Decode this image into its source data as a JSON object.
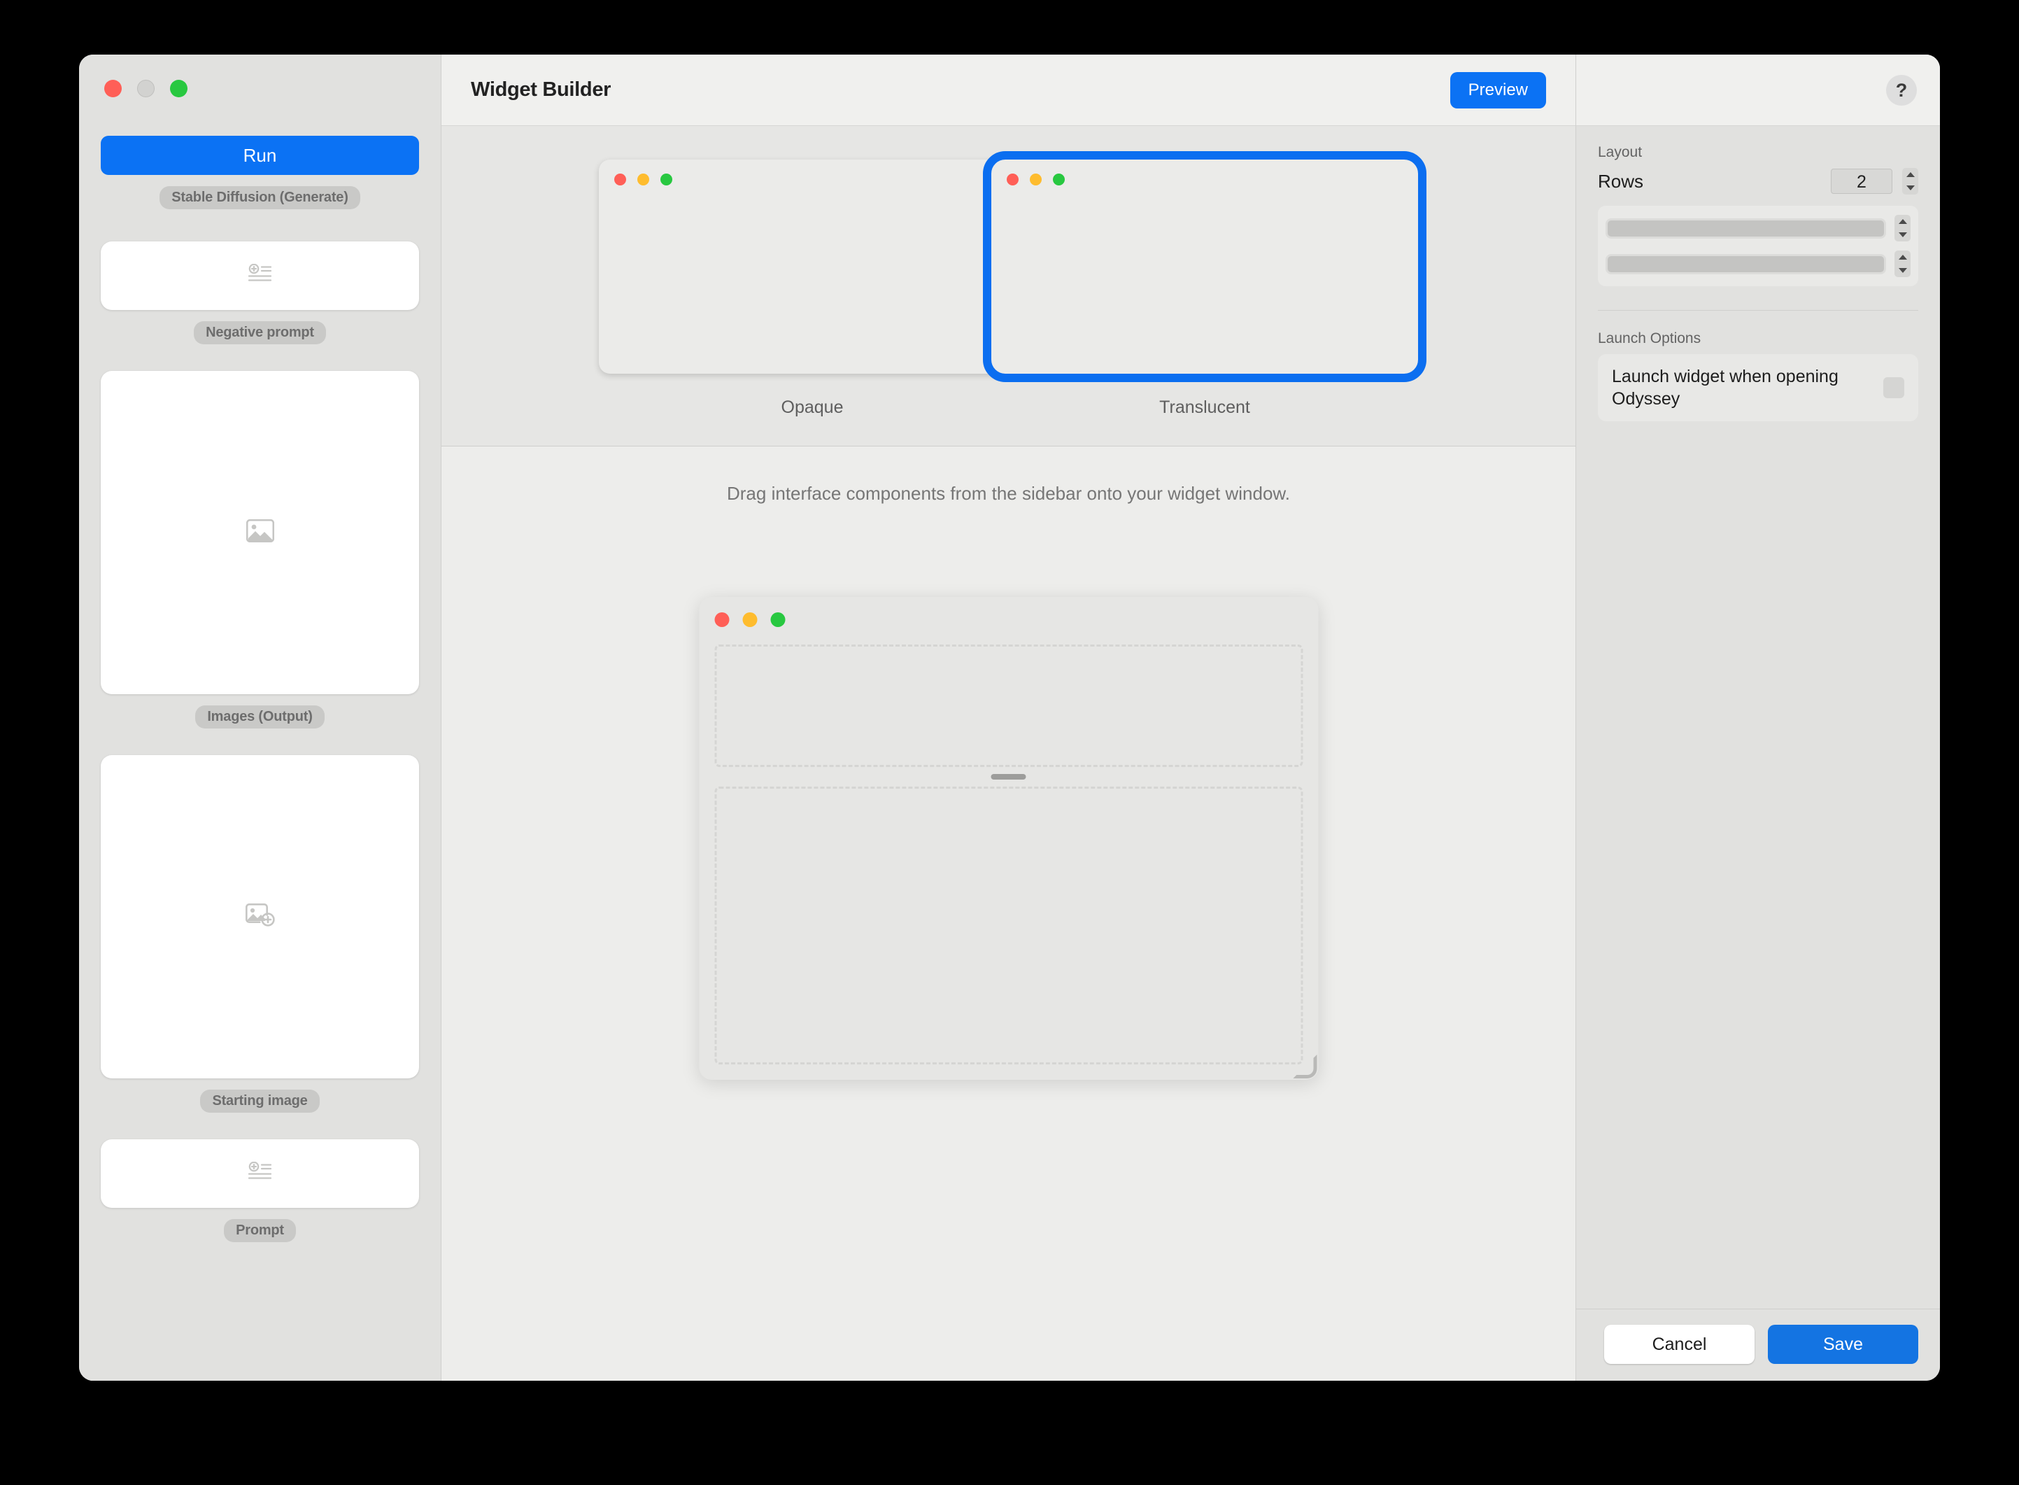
{
  "window": {
    "traffic_lights": {
      "close_color": "#ff5f57",
      "minimize_color": "#d2d2d0",
      "zoom_color": "#28c840"
    }
  },
  "sidebar": {
    "run_button_label": "Run",
    "run_button_color": "#0b72f4",
    "node_badge": "Stable Diffusion (Generate)",
    "slots": [
      {
        "label": "Negative prompt",
        "icon": "text-add-icon",
        "kind": "text"
      },
      {
        "label": "Images (Output)",
        "icon": "image-icon",
        "kind": "image"
      },
      {
        "label": "Starting image",
        "icon": "image-add-icon",
        "kind": "image"
      },
      {
        "label": "Prompt",
        "icon": "text-add-icon",
        "kind": "text"
      }
    ]
  },
  "toolbar": {
    "title": "Widget Builder",
    "preview_label": "Preview",
    "preview_color": "#0b72f4"
  },
  "style_picker": {
    "options": [
      {
        "label": "Opaque",
        "selected": false
      },
      {
        "label": "Translucent",
        "selected": true
      }
    ],
    "selection_color": "#0b6ef0"
  },
  "canvas": {
    "hint": "Drag interface components from the sidebar onto your widget window.",
    "widget_rows": 2
  },
  "inspector": {
    "help_label": "?",
    "layout": {
      "section_label": "Layout",
      "rows_label": "Rows",
      "rows_value": "2",
      "row_items": [
        "",
        ""
      ]
    },
    "launch": {
      "section_label": "Launch Options",
      "option_label": "Launch widget when opening Odyssey",
      "checked": false
    },
    "footer": {
      "cancel_label": "Cancel",
      "save_label": "Save",
      "save_color": "#1474e2"
    }
  }
}
